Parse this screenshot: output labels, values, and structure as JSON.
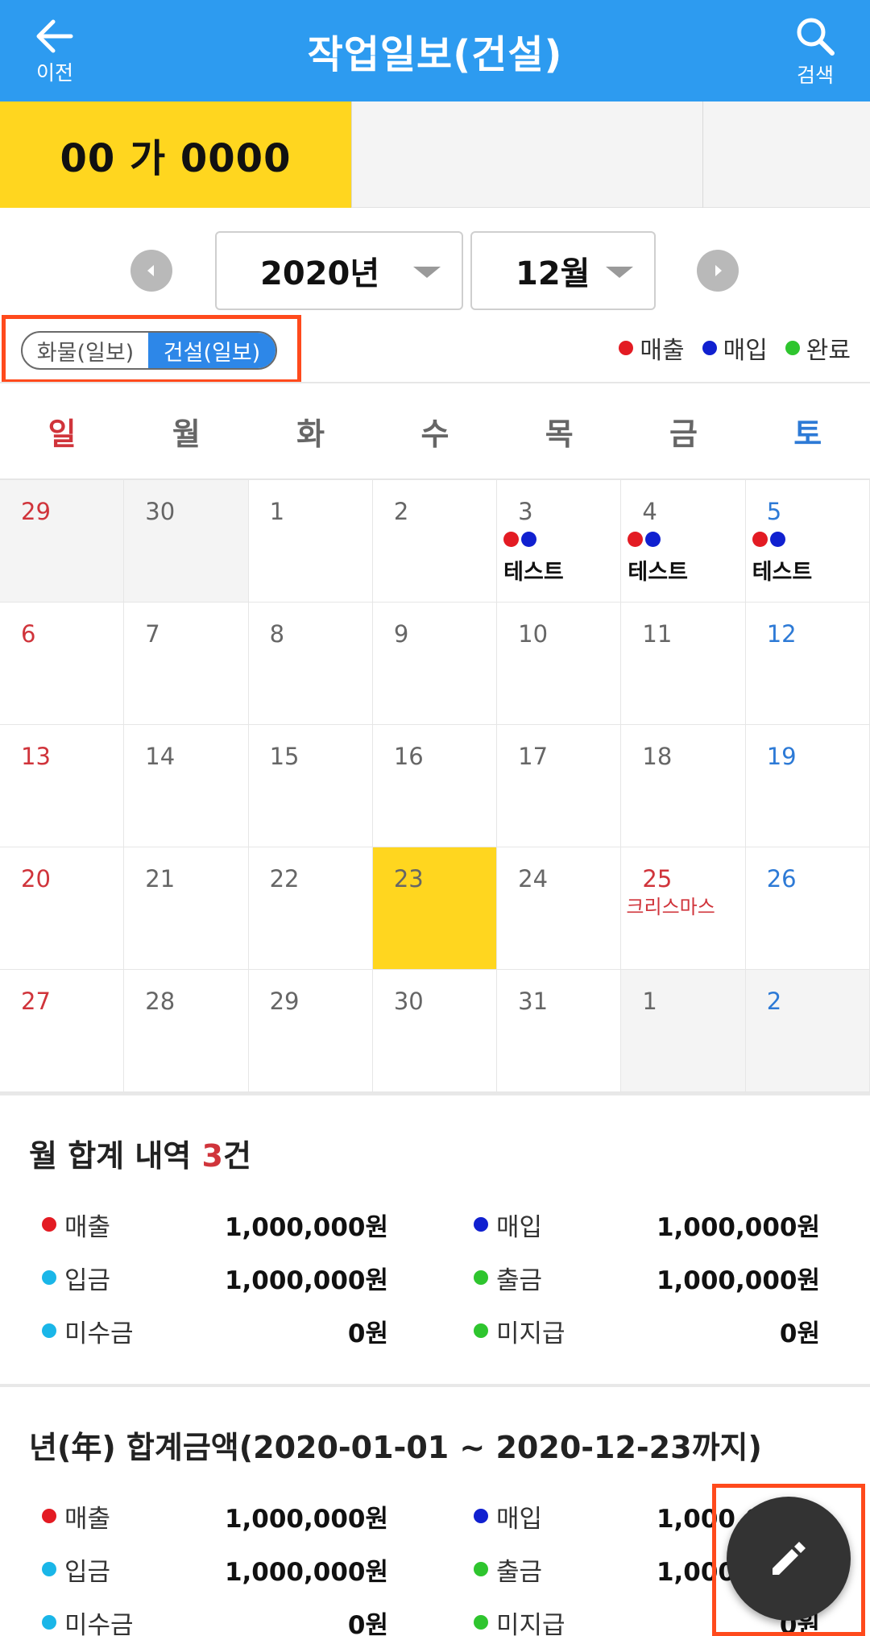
{
  "header": {
    "back_label": "이전",
    "title": "작업일보(건설)",
    "search_label": "검색"
  },
  "vehicle_tabs": [
    {
      "label": "00 가 0000",
      "selected": true
    },
    {
      "label": "",
      "selected": false
    },
    {
      "label": "",
      "selected": false
    }
  ],
  "month_selector": {
    "year": "2020년",
    "month": "12월"
  },
  "mode_toggle": {
    "options": [
      "화물(일보)",
      "건설(일보)"
    ],
    "selected": "건설(일보)"
  },
  "legend": [
    {
      "label": "매출",
      "color": "#e31b23"
    },
    {
      "label": "매입",
      "color": "#1020d0"
    },
    {
      "label": "완료",
      "color": "#2ec52e"
    }
  ],
  "weekdays": [
    "일",
    "월",
    "화",
    "수",
    "목",
    "금",
    "토"
  ],
  "calendar": {
    "today": "23",
    "weeks": [
      [
        {
          "day": "29",
          "other": true
        },
        {
          "day": "30",
          "other": true
        },
        {
          "day": "1"
        },
        {
          "day": "2"
        },
        {
          "day": "3",
          "dots": [
            "#e31b23",
            "#1020d0"
          ],
          "event": "테스트"
        },
        {
          "day": "4",
          "dots": [
            "#e31b23",
            "#1020d0"
          ],
          "event": "테스트"
        },
        {
          "day": "5",
          "dots": [
            "#e31b23",
            "#1020d0"
          ],
          "event": "테스트"
        }
      ],
      [
        {
          "day": "6"
        },
        {
          "day": "7"
        },
        {
          "day": "8"
        },
        {
          "day": "9"
        },
        {
          "day": "10"
        },
        {
          "day": "11"
        },
        {
          "day": "12"
        }
      ],
      [
        {
          "day": "13"
        },
        {
          "day": "14"
        },
        {
          "day": "15"
        },
        {
          "day": "16"
        },
        {
          "day": "17"
        },
        {
          "day": "18"
        },
        {
          "day": "19"
        }
      ],
      [
        {
          "day": "20"
        },
        {
          "day": "21"
        },
        {
          "day": "22"
        },
        {
          "day": "23",
          "today": true
        },
        {
          "day": "24"
        },
        {
          "day": "25",
          "holiday": "크리스마스"
        },
        {
          "day": "26"
        }
      ],
      [
        {
          "day": "27"
        },
        {
          "day": "28"
        },
        {
          "day": "29"
        },
        {
          "day": "30"
        },
        {
          "day": "31"
        },
        {
          "day": "1",
          "other": true
        },
        {
          "day": "2",
          "other": true
        }
      ]
    ]
  },
  "monthly_summary": {
    "title_prefix": "월 합계 내역 ",
    "count": "3",
    "title_suffix": "건",
    "rows": [
      [
        {
          "label": "매출",
          "value": "1,000,000원",
          "color": "#e31b23"
        },
        {
          "label": "매입",
          "value": "1,000,000원",
          "color": "#1020d0"
        }
      ],
      [
        {
          "label": "입금",
          "value": "1,000,000원",
          "color": "#1ab6e8"
        },
        {
          "label": "출금",
          "value": "1,000,000원",
          "color": "#2ec52e"
        }
      ],
      [
        {
          "label": "미수금",
          "value": "0원",
          "color": "#1ab6e8"
        },
        {
          "label": "미지급",
          "value": "0원",
          "color": "#2ec52e"
        }
      ]
    ]
  },
  "yearly_summary": {
    "title": "년(年) 합계금액(2020-01-01 ~ 2020-12-23까지)",
    "rows": [
      [
        {
          "label": "매출",
          "value": "1,000,000원",
          "color": "#e31b23"
        },
        {
          "label": "매입",
          "value": "1,000,000원",
          "color": "#1020d0"
        }
      ],
      [
        {
          "label": "입금",
          "value": "1,000,000원",
          "color": "#1ab6e8"
        },
        {
          "label": "출금",
          "value": "1,000,000원",
          "color": "#2ec52e"
        }
      ],
      [
        {
          "label": "미수금",
          "value": "0원",
          "color": "#1ab6e8"
        },
        {
          "label": "미지급",
          "value": "0원",
          "color": "#2ec52e"
        }
      ]
    ]
  },
  "fab": {
    "icon": "pencil-icon"
  }
}
